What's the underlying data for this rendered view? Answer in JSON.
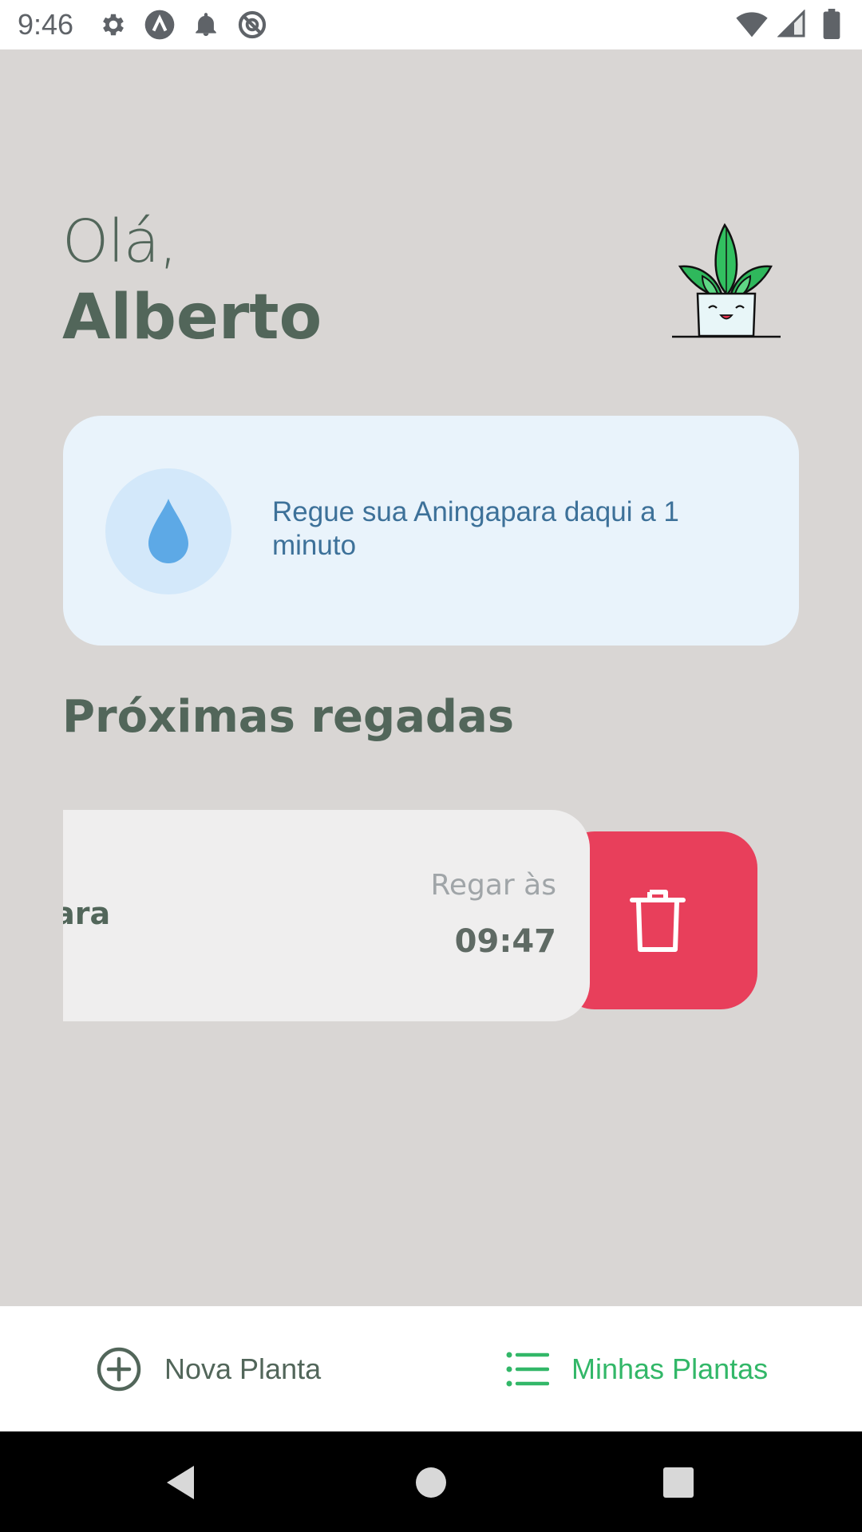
{
  "status_bar": {
    "time": "9:46",
    "icons_left": [
      "settings-icon",
      "app-icon",
      "notification-icon",
      "dnd-icon"
    ],
    "icons_right": [
      "wifi-icon",
      "signal-icon",
      "battery-icon"
    ]
  },
  "greeting": {
    "hello": "Olá,",
    "name": "Alberto"
  },
  "tip": {
    "text": "Regue sua Aningapara daqui a 1 minuto",
    "icon": "water-drop-icon"
  },
  "section": {
    "title": "Próximas regadas"
  },
  "plants": [
    {
      "name": "Aningapara",
      "visible_name": "ngapara",
      "water_label": "Regar às",
      "water_time": "09:47"
    }
  ],
  "tabs": [
    {
      "label": "Nova Planta",
      "icon": "plus-circle-icon",
      "active": false
    },
    {
      "label": "Minhas Plantas",
      "icon": "list-icon",
      "active": true
    }
  ],
  "colors": {
    "background": "#d9d6d4",
    "heading": "#52665a",
    "accent_green": "#32b768",
    "delete_red": "#e83f5b",
    "tip_bg": "#e9f3fb",
    "tip_text": "#3d7199"
  }
}
